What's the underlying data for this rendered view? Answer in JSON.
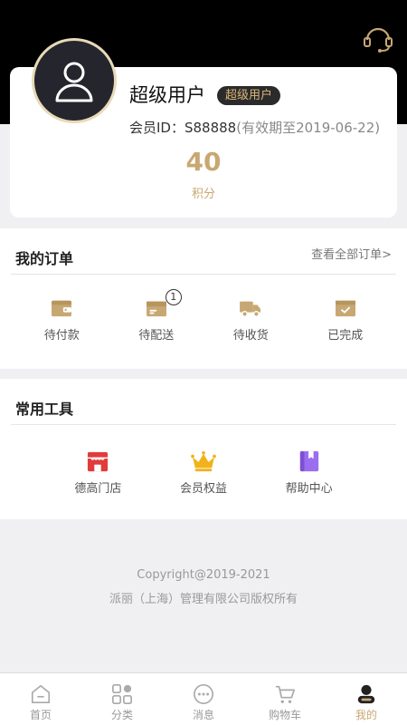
{
  "profile": {
    "username": "超级用户",
    "level_badge": "超级用户",
    "member_id_text": "会员ID：S88888",
    "expiry_text": "(有效期至2019-06-22)",
    "points_value": "40",
    "points_label": "积分"
  },
  "orders": {
    "title": "我的订单",
    "view_all": "查看全部订单>",
    "items": [
      {
        "label": "待付款",
        "icon": "wallet-icon"
      },
      {
        "label": "待配送",
        "icon": "package-icon",
        "badge": "1"
      },
      {
        "label": "待收货",
        "icon": "truck-icon"
      },
      {
        "label": "已完成",
        "icon": "box-check-icon"
      }
    ]
  },
  "tools": {
    "title": "常用工具",
    "items": [
      {
        "label": "德高门店",
        "icon": "store-icon"
      },
      {
        "label": "会员权益",
        "icon": "crown-icon"
      },
      {
        "label": "帮助中心",
        "icon": "book-icon"
      }
    ]
  },
  "footer": {
    "copyright": "Copyright@2019-2021",
    "company": "派丽（上海）管理有限公司版权所有"
  },
  "tabbar": {
    "items": [
      {
        "label": "首页",
        "icon": "home-icon"
      },
      {
        "label": "分类",
        "icon": "category-icon"
      },
      {
        "label": "消息",
        "icon": "message-icon"
      },
      {
        "label": "购物车",
        "icon": "cart-icon"
      },
      {
        "label": "我的",
        "icon": "profile-icon",
        "active": true
      }
    ]
  },
  "colors": {
    "accent_gold": "#c8a872",
    "header_black": "#000000",
    "store_red": "#e03c3c",
    "crown_yellow": "#f2b21a",
    "book_purple": "#9b6ef0"
  }
}
